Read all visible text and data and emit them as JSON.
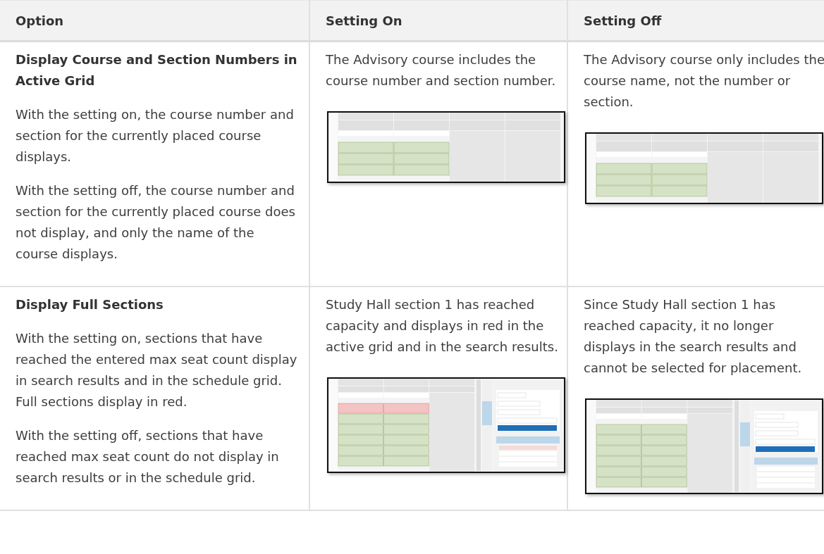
{
  "table": {
    "columns": [
      "Option",
      "Setting On",
      "Setting Off"
    ],
    "rows": [
      {
        "option": {
          "title": "Display Course and Section Numbers in Active Grid",
          "paragraphs": [
            "With the setting on, the course number and section for the currently placed course displays.",
            "With the setting off, the course number and section for the currently placed course does not display, and only the name of the course displays."
          ]
        },
        "on": {
          "text": "The Advisory course includes the course number and section number.",
          "screenshot": {
            "kind": "grid"
          }
        },
        "off": {
          "text": "The Advisory course only includes the course name, not the number or section.",
          "screenshot": {
            "kind": "grid"
          }
        }
      },
      {
        "option": {
          "title": "Display Full Sections",
          "paragraphs": [
            "With the setting on, sections that have reached the entered max seat count display in search results and in the schedule grid. Full sections display in red.",
            "With the setting off, sections that have reached max seat count do not display in search results or in the schedule grid."
          ]
        },
        "on": {
          "text": "Study Hall section 1 has reached capacity and displays in red in the active grid and in the search results.",
          "screenshot": {
            "kind": "grid-search-full"
          }
        },
        "off": {
          "text": "Since Study Hall section 1 has reached capacity, it no longer displays in the search results and cannot be selected for placement.",
          "screenshot": {
            "kind": "grid-search"
          }
        }
      }
    ]
  }
}
